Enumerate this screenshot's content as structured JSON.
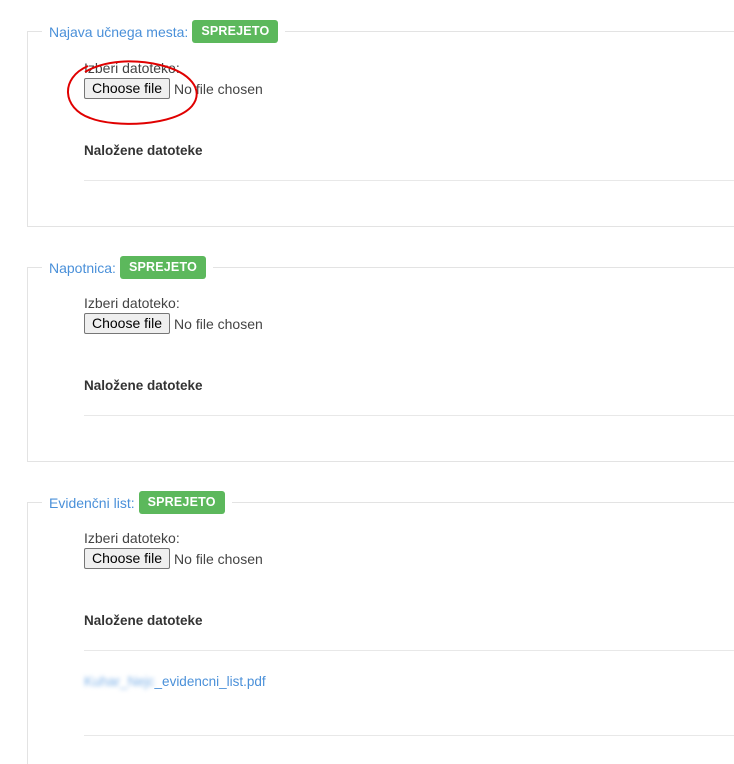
{
  "sections": [
    {
      "title": "Najava učnega mesta:",
      "badge": "SPREJETO",
      "field_label": "Izberi datoteko:",
      "button_label": "Choose file",
      "file_status": "No file chosen",
      "uploaded_label": "Naložene datoteke"
    },
    {
      "title": "Napotnica:",
      "badge": "SPREJETO",
      "field_label": "Izberi datoteko:",
      "button_label": "Choose file",
      "file_status": "No file chosen",
      "uploaded_label": "Naložene datoteke"
    },
    {
      "title": "Evidenčni list:",
      "badge": "SPREJETO",
      "field_label": "Izberi datoteko:",
      "button_label": "Choose file",
      "file_status": "No file chosen",
      "uploaded_label": "Naložene datoteke",
      "files": [
        {
          "name_redacted": "Kuhar_Nejc",
          "name_suffix": "_evidencni_list.pdf"
        }
      ]
    }
  ],
  "colors": {
    "badge": "#5cb85c",
    "legend_text": "#4a90d9",
    "annotation": "#e00000"
  }
}
